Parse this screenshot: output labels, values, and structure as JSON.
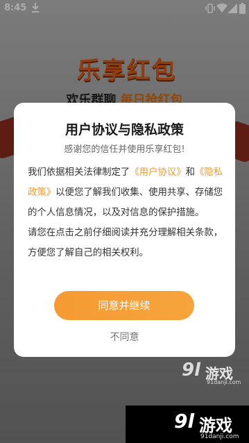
{
  "status_bar": {
    "time": "8:45",
    "icons": [
      "download-icon",
      "vibrate-icon",
      "wifi-icon",
      "signal-icon",
      "battery-icon"
    ]
  },
  "background": {
    "logo_text": "乐享红包",
    "subtitle_part1": "欢乐群聊",
    "subtitle_part2": "每日抢红包"
  },
  "dialog": {
    "title": "用户协议与隐私政策",
    "subtitle": "感谢您的信任并使用乐享红包!",
    "para1_pre": "我们依据相关法律制定了",
    "user_agreement_link": "《用户协议》",
    "para1_and": "和",
    "privacy_policy_link": "《隐私政策》",
    "para1_post": "以便您了解我们收集、使用共享、存储您的个人信息情况，以及对信息的保护措施。",
    "para2": "请您在点击之前仔细阅读并充分理解相关条款，方便您了解自己的相关权利。",
    "agree_label": "同意并继续",
    "disagree_label": "不同意"
  },
  "colors": {
    "accent": "#f59a33",
    "link": "#f29a2e"
  },
  "watermarks": {
    "mid_logo": "9l",
    "mid_text": "游戏",
    "mid_url": "91danji.com",
    "bar_logo": "9l",
    "bar_text": "游戏",
    "bar_url": "91danji.com"
  }
}
